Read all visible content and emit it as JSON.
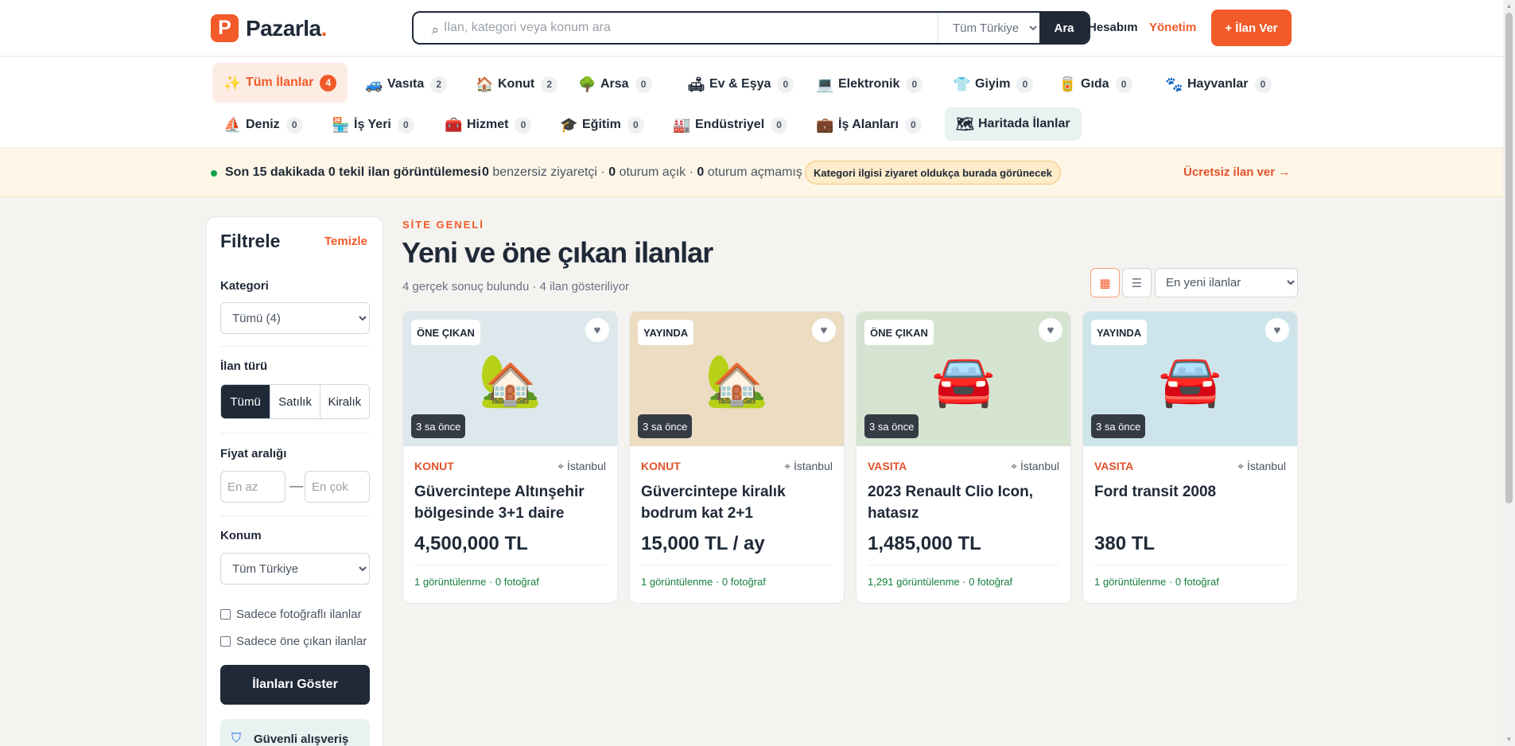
{
  "header": {
    "logo_letter": "P",
    "logo_name": "Pazarla",
    "logo_dot": ".",
    "search_placeholder": "İlan, kategori veya konum ara",
    "location_value": "Tüm Türkiye",
    "search_button": "Ara",
    "account_link": "Hesabım",
    "admin_link": "Yönetim",
    "post_button": "+ İlan Ver"
  },
  "categories": [
    {
      "label": "Tüm İlanlar",
      "count": "4",
      "icon": "sparkle-icon",
      "glyph": "✨"
    },
    {
      "label": "Vasıta",
      "count": "2",
      "icon": "car-icon",
      "glyph": "🚙"
    },
    {
      "label": "Konut",
      "count": "2",
      "icon": "house-icon",
      "glyph": "🏠"
    },
    {
      "label": "Arsa",
      "count": "0",
      "icon": "tree-icon",
      "glyph": "🌳"
    },
    {
      "label": "Ev & Eşya",
      "count": "0",
      "icon": "sofa-icon",
      "glyph": "🛋"
    },
    {
      "label": "Elektronik",
      "count": "0",
      "icon": "laptop-icon",
      "glyph": "💻"
    },
    {
      "label": "Giyim",
      "count": "0",
      "icon": "shirt-icon",
      "glyph": "👕"
    },
    {
      "label": "Gıda",
      "count": "0",
      "icon": "food-icon",
      "glyph": "🥫"
    },
    {
      "label": "Hayvanlar",
      "count": "0",
      "icon": "paw-icon",
      "glyph": "🐾"
    },
    {
      "label": "Deniz",
      "count": "0",
      "icon": "boat-icon",
      "glyph": "⛵"
    },
    {
      "label": "İş Yeri",
      "count": "0",
      "icon": "shop-icon",
      "glyph": "🏪"
    },
    {
      "label": "Hizmet",
      "count": "0",
      "icon": "toolbox-icon",
      "glyph": "🧰"
    },
    {
      "label": "Eğitim",
      "count": "0",
      "icon": "graduation-cap-icon",
      "glyph": "🎓"
    },
    {
      "label": "Endüstriyel",
      "count": "0",
      "icon": "factory-icon",
      "glyph": "🏭"
    },
    {
      "label": "İş Alanları",
      "count": "0",
      "icon": "briefcase-icon",
      "glyph": "💼"
    },
    {
      "label": "Haritada İlanlar",
      "icon": "map-icon",
      "glyph": "🗺"
    }
  ],
  "notice": {
    "main": "Son 15 dakikada 0 tekil ilan görüntülemesi",
    "visitors_count": "0",
    "visitors_label": "benzersiz ziyaretçi ·",
    "open_count": "0",
    "open_label": "oturum açık ·",
    "closed_count": "0",
    "closed_label": "oturum açmamış",
    "pill": "Kategori ilgisi ziyaret oldukça burada görünecek",
    "cta": "Ücretsiz ilan ver →"
  },
  "filters": {
    "title": "Filtrele",
    "clear": "Temizle",
    "category_label": "Kategori",
    "category_value": "Tümü (4)",
    "type_label": "İlan türü",
    "type_options": [
      "Tümü",
      "Satılık",
      "Kiralık"
    ],
    "price_label": "Fiyat aralığı",
    "price_min_placeholder": "En az",
    "price_max_placeholder": "En çok",
    "price_sep": "—",
    "location_label": "Konum",
    "location_value": "Tüm Türkiye",
    "only_photos": "Sadece fotoğraflı ilanlar",
    "only_featured": "Sadece öne çıkan ilanlar",
    "show_button": "İlanları Göster",
    "safe_title": "Güvenli alışveriş"
  },
  "main": {
    "eyebrow": "SİTE GENELİ",
    "title": "Yeni ve öne çıkan ilanlar",
    "result_text": "4 gerçek sonuç bulundu · 4 ilan gösteriliyor",
    "sort_value": "En yeni ilanlar"
  },
  "listings": [
    {
      "badge": "ÖNE ÇIKAN",
      "ago": "3 sa önce",
      "category": "KONUT",
      "location": "İstanbul",
      "title": "Güvercintepe Altınşehir bölgesinde 3+1 daire",
      "price": "4,500,000 TL",
      "meta": "1 görüntülenme · 0 fotoğraf",
      "image": "house-icon",
      "glyph": "🏡",
      "bg": "#dce8ec"
    },
    {
      "badge": "YAYINDA",
      "ago": "3 sa önce",
      "category": "KONUT",
      "location": "İstanbul",
      "title": "Güvercintepe kiralık bodrum kat 2+1",
      "price": "15,000 TL / ay",
      "meta": "1 görüntülenme · 0 fotoğraf",
      "image": "house-icon",
      "glyph": "🏡",
      "bg": "#ebdcc2"
    },
    {
      "badge": "ÖNE ÇIKAN",
      "ago": "3 sa önce",
      "category": "VASITA",
      "location": "İstanbul",
      "title": "2023 Renault Clio Icon, hatasız",
      "price": "1,485,000 TL",
      "meta": "1,291 görüntülenme · 0 fotoğraf",
      "image": "car-icon",
      "glyph": "🚘",
      "bg": "#d5e4d1"
    },
    {
      "badge": "YAYINDA",
      "ago": "3 sa önce",
      "category": "VASITA",
      "location": "İstanbul",
      "title": "Ford transit 2008",
      "price": "380 TL",
      "meta": "1 görüntülenme · 0 fotoğraf",
      "image": "car-icon",
      "glyph": "🚘",
      "bg": "#cde5ea"
    }
  ],
  "colors": {
    "accent": "#f25a29",
    "dark": "#1f2937",
    "notice_bg": "#fdf6e6",
    "meta_green": "#16803c"
  }
}
